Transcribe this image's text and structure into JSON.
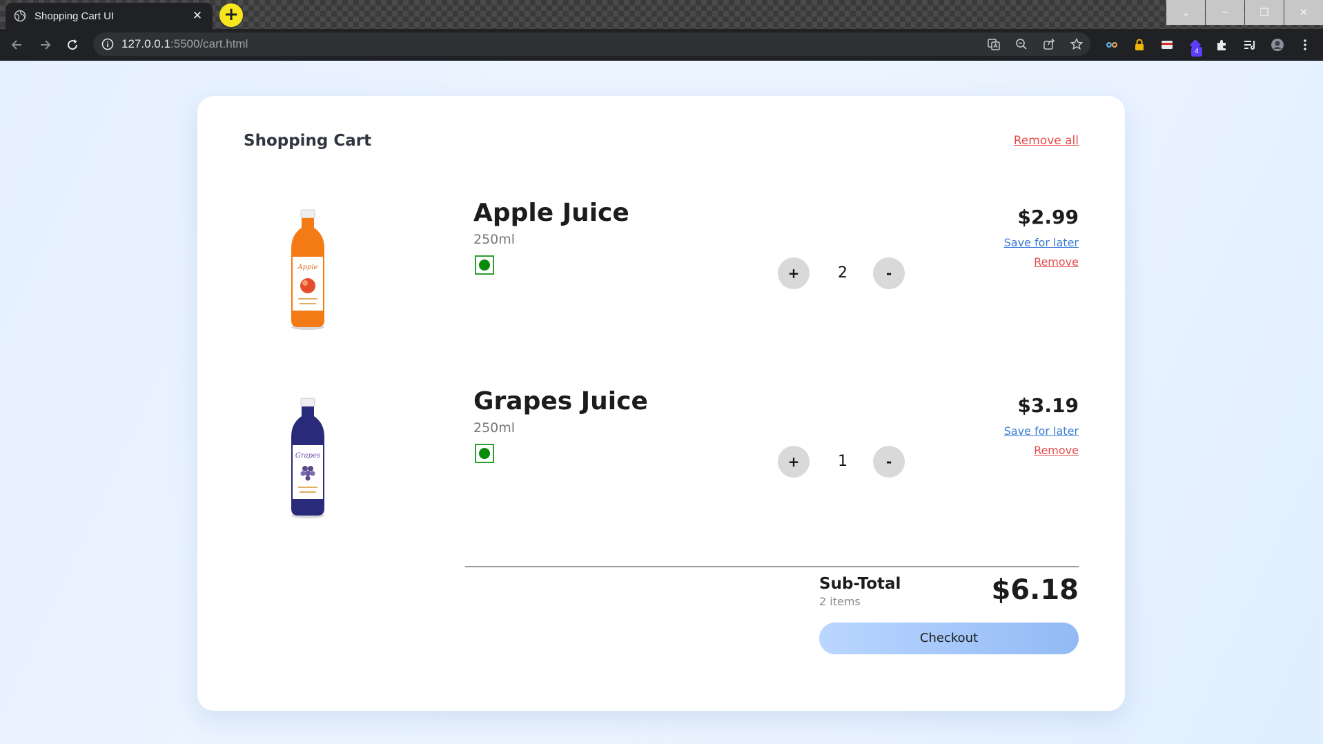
{
  "browser": {
    "tab_title": "Shopping Cart UI",
    "tab_close": "✕",
    "new_tab": "+",
    "url_host": "127.0.0.1",
    "url_path": ":5500/cart.html",
    "extension_badge": "4"
  },
  "cart": {
    "title": "Shopping Cart",
    "remove_all": "Remove all",
    "items": [
      {
        "name": "Apple Juice",
        "volume": "250ml",
        "quantity": "2",
        "price": "$2.99",
        "plus": "+",
        "minus": "-",
        "save_for_later": "Save for later",
        "remove": "Remove",
        "bottle_color": "#f47a16"
      },
      {
        "name": "Grapes Juice",
        "volume": "250ml",
        "quantity": "1",
        "price": "$3.19",
        "plus": "+",
        "minus": "-",
        "save_for_later": "Save for later",
        "remove": "Remove",
        "bottle_color": "#2a2a7a"
      }
    ],
    "subtotal": {
      "label": "Sub-Total",
      "count": "2 items",
      "amount": "$6.18"
    },
    "checkout_label": "Checkout"
  },
  "colors": {
    "accent_red": "#e44c4c",
    "accent_blue": "#3a7bd5",
    "veg_green": "#0a8a0a"
  }
}
